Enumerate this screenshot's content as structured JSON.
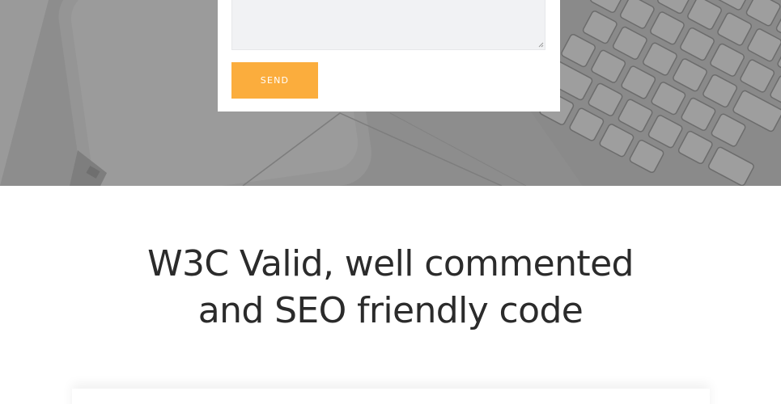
{
  "contact_form": {
    "message_value": "",
    "send_label": "SEND"
  },
  "feature": {
    "heading_line1": "W3C Valid, well commented",
    "heading_line2": "and SEO friendly code"
  },
  "colors": {
    "accent": "#fbad3d",
    "hero_bg": "#8c8c8c",
    "heading_text": "#2b2b2b",
    "textarea_bg": "#f1f2f4"
  }
}
